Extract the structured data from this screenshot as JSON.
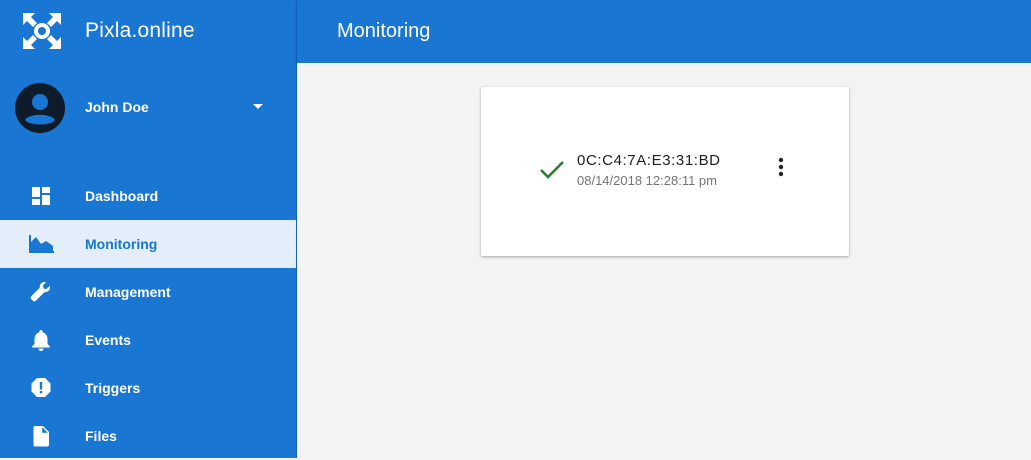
{
  "app": {
    "name": "Pixla.online",
    "logo_icon": "pixla-logo-icon"
  },
  "user": {
    "name": "John Doe",
    "avatar_icon": "account-circle-icon",
    "menu_icon": "caret-down-icon"
  },
  "sidebar": {
    "items": [
      {
        "label": "Dashboard",
        "icon": "dashboard-icon",
        "active": false
      },
      {
        "label": "Monitoring",
        "icon": "area-chart-icon",
        "active": true
      },
      {
        "label": "Management",
        "icon": "wrench-icon",
        "active": false
      },
      {
        "label": "Events",
        "icon": "bell-icon",
        "active": false
      },
      {
        "label": "Triggers",
        "icon": "alert-octagon-icon",
        "active": false
      },
      {
        "label": "Files",
        "icon": "file-icon",
        "active": false
      }
    ]
  },
  "header": {
    "title": "Monitoring"
  },
  "devices": [
    {
      "id": "0C:C4:7A:E3:31:BD",
      "last_seen": "08/14/2018 12:28:11 pm",
      "status": "ok",
      "status_icon": "check-icon",
      "menu_icon": "more-vert-icon"
    }
  ],
  "colors": {
    "primary": "#1976d2",
    "active_item_bg": "#e3eefa",
    "status_ok": "#2e7d32",
    "content_bg": "#f3f3f3"
  }
}
